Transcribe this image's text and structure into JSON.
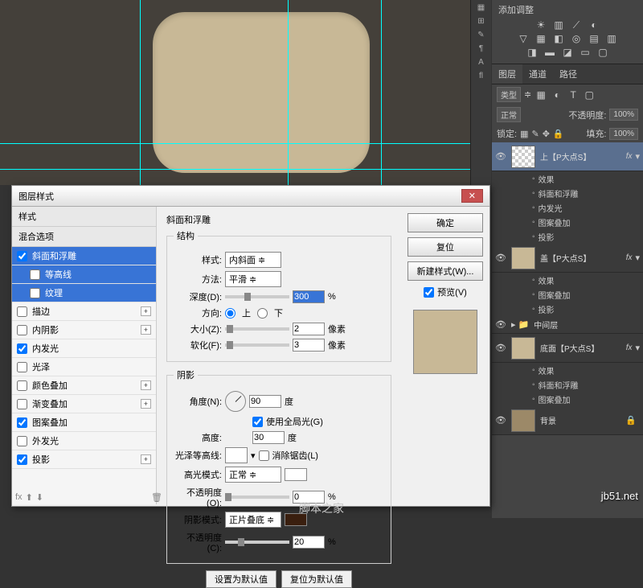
{
  "dialog": {
    "title": "图层样式",
    "styles_header": "样式",
    "blend_header": "混合选项",
    "items": {
      "bevel": "斜面和浮雕",
      "contour": "等高线",
      "texture": "纹理",
      "stroke": "描边",
      "inner_shadow": "内阴影",
      "inner_glow": "内发光",
      "satin": "光泽",
      "color_overlay": "颜色叠加",
      "gradient_overlay": "渐变叠加",
      "pattern_overlay": "图案叠加",
      "outer_glow": "外发光",
      "drop_shadow": "投影"
    },
    "bevel": {
      "title": "斜面和浮雕",
      "structure": "结构",
      "style_label": "样式:",
      "style_val": "内斜面",
      "technique_label": "方法:",
      "technique_val": "平滑",
      "depth_label": "深度(D):",
      "depth_val": "300",
      "depth_unit": "%",
      "direction_label": "方向:",
      "dir_up": "上",
      "dir_down": "下",
      "size_label": "大小(Z):",
      "size_val": "2",
      "size_unit": "像素",
      "soften_label": "软化(F):",
      "soften_val": "3",
      "soften_unit": "像素",
      "shading": "阴影",
      "angle_label": "角度(N):",
      "angle_val": "90",
      "angle_unit": "度",
      "global_light": "使用全局光(G)",
      "altitude_label": "高度:",
      "altitude_val": "30",
      "altitude_unit": "度",
      "gloss_label": "光泽等高线:",
      "antialias": "消除锯齿(L)",
      "highlight_mode_label": "高光模式:",
      "highlight_mode_val": "正常",
      "opacity_label": "不透明度(O):",
      "highlight_opacity_val": "0",
      "shadow_mode_label": "阴影模式:",
      "shadow_mode_val": "正片叠底",
      "shadow_opacity_label": "不透明度(C):",
      "shadow_opacity_val": "20",
      "pct": "%",
      "make_default": "设置为默认值",
      "reset_default": "复位为默认值"
    },
    "buttons": {
      "ok": "确定",
      "cancel": "复位",
      "new_style": "新建样式(W)...",
      "preview": "预览(V)"
    }
  },
  "panels": {
    "adjustments_title": "添加调整",
    "tabs": {
      "layers": "图层",
      "channels": "通道",
      "paths": "路径"
    },
    "kind": "类型",
    "blend_mode": "正常",
    "opacity_label": "不透明度:",
    "opacity_val": "100%",
    "lock_label": "锁定:",
    "fill_label": "填充:",
    "fill_val": "100%",
    "layers": {
      "top": "上【P大点S】",
      "fx": "fx",
      "effects": "效果",
      "bevel": "斜面和浮雕",
      "inner_glow": "内发光",
      "pattern": "图案叠加",
      "shadow": "投影",
      "cover": "盖【P大点S】",
      "mid": "中间层",
      "bottom": "底面【P大点S】",
      "bg": "背景"
    }
  },
  "watermark": "jb51.net",
  "footer": "脚本之家"
}
